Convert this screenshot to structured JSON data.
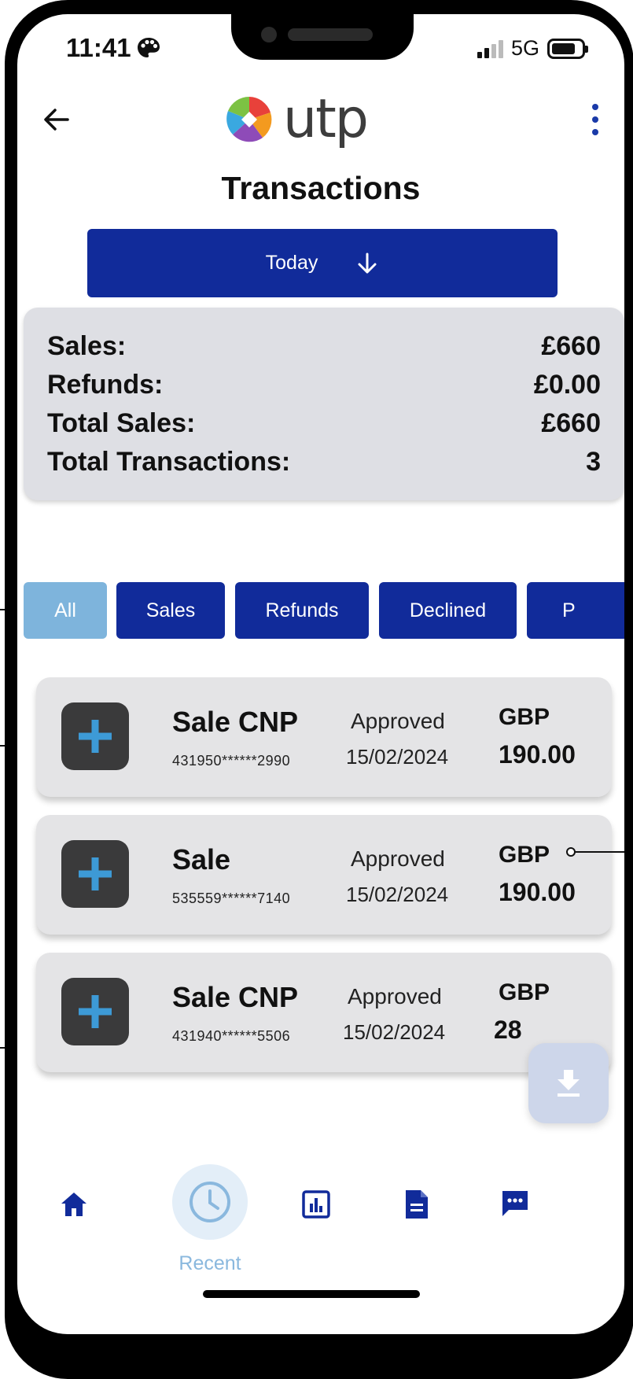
{
  "status_bar": {
    "time": "11:41",
    "network": "5G"
  },
  "brand": {
    "name": "utp"
  },
  "page": {
    "title": "Transactions"
  },
  "date_filter": {
    "label": "Today"
  },
  "summary": {
    "rows": [
      {
        "label": "Sales:",
        "value": "£660"
      },
      {
        "label": "Refunds:",
        "value": "£0.00"
      },
      {
        "label": "Total Sales:",
        "value": "£660"
      },
      {
        "label": "Total Transactions:",
        "value": "3"
      }
    ]
  },
  "filters": [
    {
      "label": "All",
      "active": true
    },
    {
      "label": "Sales"
    },
    {
      "label": "Refunds"
    },
    {
      "label": "Declined"
    },
    {
      "label": "P"
    }
  ],
  "transactions": [
    {
      "type": "Sale CNP",
      "card": "431950******2990",
      "status": "Approved",
      "date": "15/02/2024",
      "currency": "GBP",
      "amount": "190.00"
    },
    {
      "type": "Sale",
      "card": "535559******7140",
      "status": "Approved",
      "date": "15/02/2024",
      "currency": "GBP",
      "amount": "190.00"
    },
    {
      "type": "Sale CNP",
      "card": "431940******5506",
      "status": "Approved",
      "date": "15/02/2024",
      "currency": "GBP",
      "amount": "28"
    }
  ],
  "bottom_nav": {
    "active_label": "Recent"
  },
  "colors": {
    "primary": "#112b9a",
    "active_chip": "#7eb4dc",
    "summary_bg": "#dedfe4",
    "card_bg": "#e4e4e6",
    "plus": "#3d9ad6"
  }
}
